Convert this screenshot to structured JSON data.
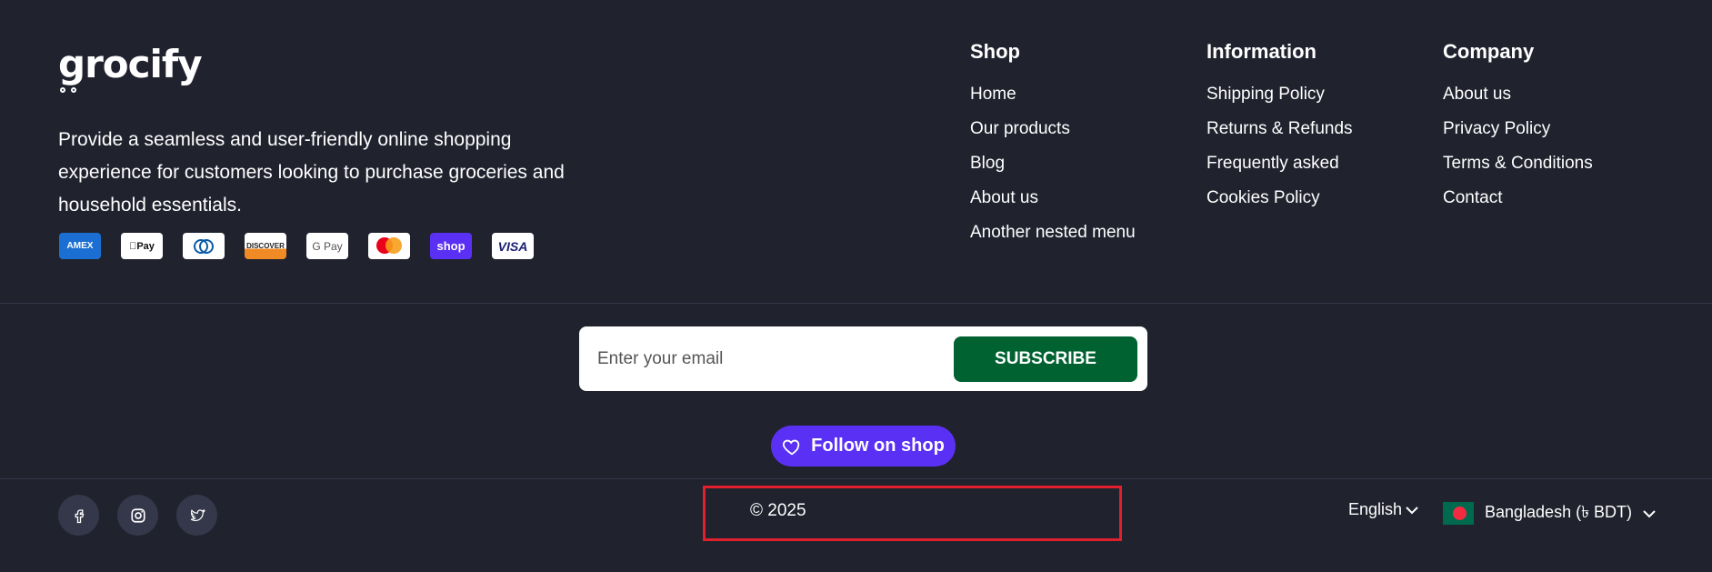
{
  "brand": {
    "name": "grocify"
  },
  "tagline": "Provide a seamless and user-friendly online shopping experience for customers looking to purchase groceries and household essentials.",
  "payments": [
    "AMEX",
    "Pay",
    "",
    "DISCOVER",
    "G Pay",
    "",
    "shop",
    "VISA"
  ],
  "menus": {
    "shop": {
      "title": "Shop",
      "items": [
        "Home",
        "Our products",
        "Blog",
        "About us",
        "Another nested menu"
      ]
    },
    "information": {
      "title": "Information",
      "items": [
        "Shipping Policy",
        "Returns & Refunds",
        "Frequently asked",
        "Cookies Policy"
      ]
    },
    "company": {
      "title": "Company",
      "items": [
        "About us",
        "Privacy Policy",
        "Terms & Conditions",
        "Contact"
      ]
    }
  },
  "newsletter": {
    "placeholder": "Enter your email",
    "button": "SUBSCRIBE"
  },
  "follow": {
    "label": "Follow on shop"
  },
  "social": [
    "facebook-icon",
    "instagram-icon",
    "twitter-icon"
  ],
  "copyright": "© 2025",
  "locale": {
    "language": "English",
    "country": "Bangladesh (৳ BDT)"
  },
  "colors": {
    "background": "#20222e",
    "subscribe": "#006131",
    "shop_purple": "#5a31f4",
    "highlight_box": "#e0202d"
  }
}
